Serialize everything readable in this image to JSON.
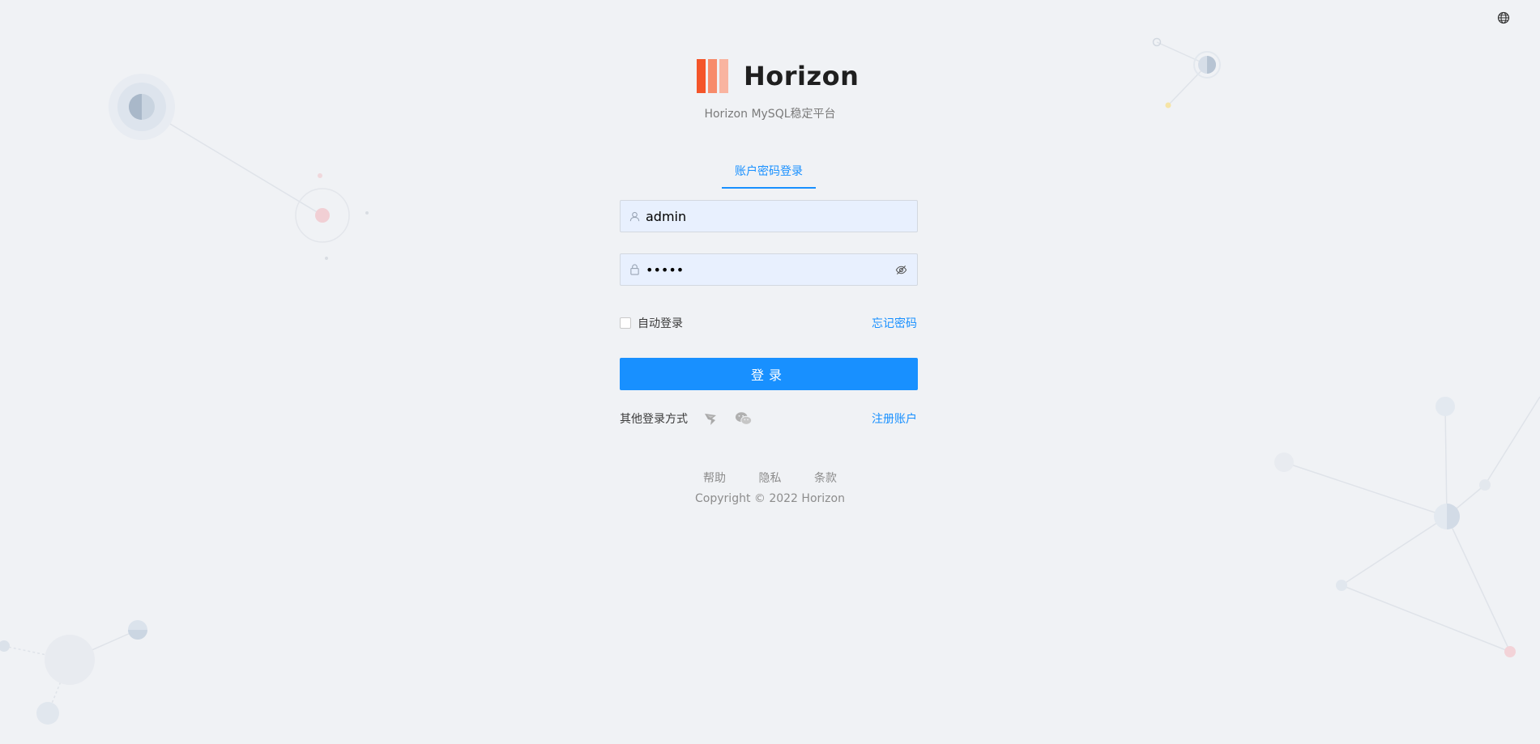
{
  "brand": {
    "name": "Horizon",
    "subtitle": "Horizon MySQL稳定平台",
    "colors": [
      "#f4552a",
      "#f78b6b",
      "#f9b4a0"
    ]
  },
  "tabs": [
    {
      "label": "账户密码登录",
      "active": true
    }
  ],
  "form": {
    "username_value": "admin",
    "password_value": "admin",
    "remember_label": "自动登录",
    "remember_checked": false,
    "forgot_label": "忘记密码",
    "submit_label": "登录"
  },
  "other_login": {
    "label": "其他登录方式",
    "methods": [
      "feishu-icon",
      "wechat-icon"
    ],
    "register_label": "注册账户"
  },
  "footer": {
    "links": [
      "帮助",
      "隐私",
      "条款"
    ],
    "copyright": "Copyright © 2022 Horizon"
  },
  "icons": {
    "language": "globe-icon",
    "username_prefix": "user-icon",
    "password_prefix": "lock-icon",
    "password_toggle": "eye-invisible-icon"
  },
  "accent_color": "#1890ff"
}
